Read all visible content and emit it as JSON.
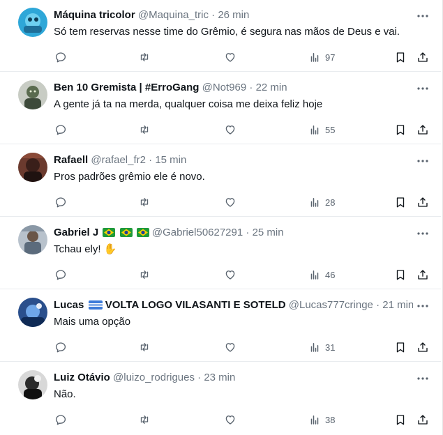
{
  "tweets": [
    {
      "name": "Máquina tricolor",
      "handle": "@Maquina_tric",
      "separator": "·",
      "time": "26 min",
      "text": "Só tem reservas nesse time do Grêmio, é segura nas mãos de Deus e vai.",
      "views": "97",
      "avatar_color": "#2ea7d8"
    },
    {
      "name": "Ben 10 Gremista | #ErroGang",
      "handle": "@Not969",
      "separator": "·",
      "time": "22 min",
      "text": "A gente já ta na merda, qualquer coisa me deixa feliz hoje",
      "views": "55",
      "avatar_color": "#3d4a3a"
    },
    {
      "name": "Rafaell",
      "handle": "@rafael_fr2",
      "separator": "·",
      "time": "15 min",
      "text": "Pros padrões grêmio ele é novo.",
      "views": "28",
      "avatar_color": "#4a2a26"
    },
    {
      "name": "Gabriel J",
      "handle": "@Gabriel50627291",
      "separator": "·",
      "time": "25 min",
      "text": "Tchau ely!",
      "emoji": "✋",
      "views": "46",
      "avatar_color": "#8a98a6"
    },
    {
      "name": "Lucas",
      "name_suffix": "VOLTA LOGO VILASANTI E SOTELD",
      "handle": "@Lucas777cringe",
      "separator": "·",
      "time": "21 min",
      "text": "Mais uma opção",
      "views": "31",
      "avatar_color": "#2a4f8c"
    },
    {
      "name": "Luiz Otávio",
      "handle": "@luizo_rodrigues",
      "separator": "·",
      "time": "23 min",
      "text": "Não.",
      "views": "38",
      "avatar_color": "#2b2b2b"
    }
  ],
  "icons": {
    "reply": "reply-icon",
    "retweet": "retweet-icon",
    "like": "heart-icon",
    "views": "views-icon",
    "bookmark": "bookmark-icon",
    "share": "share-icon",
    "more": "more-icon"
  },
  "colors": {
    "text": "#0f1419",
    "muted": "#6b7580",
    "icon": "#59636e",
    "divider": "#e9ecef"
  }
}
